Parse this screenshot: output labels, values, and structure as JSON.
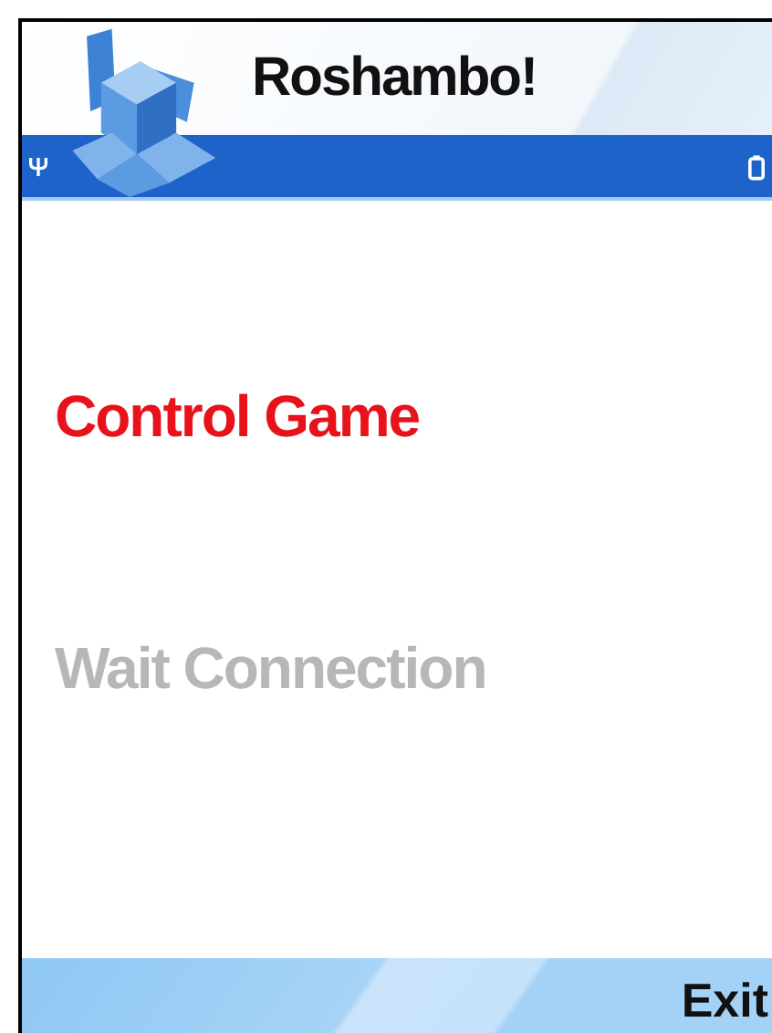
{
  "title_bar": {
    "title": "Roshambo!"
  },
  "menu": [
    {
      "label": "Control Game",
      "selected": true
    },
    {
      "label": "Wait Connection",
      "selected": false
    }
  ],
  "softkeys": {
    "right": "Exit"
  }
}
